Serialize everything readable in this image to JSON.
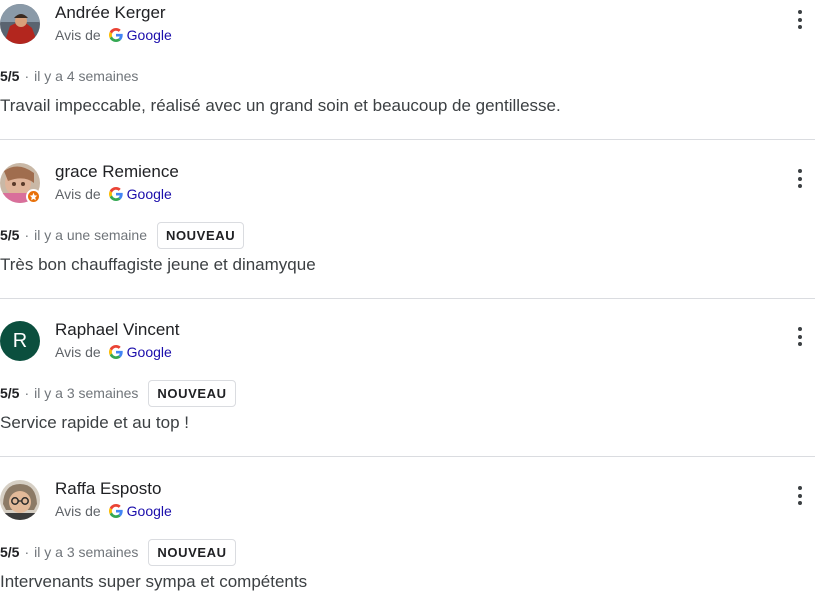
{
  "source_prefix": "Avis de",
  "source_name": "Google",
  "colors": {
    "name": "#202124",
    "muted": "#70757a",
    "link": "#1a0dab",
    "divider": "#dadce0",
    "avatar_raphael": "#0b4f3e",
    "local_guide_badge": "#e8710a"
  },
  "icons": {
    "source": "google-g-icon",
    "menu": "more-vertical-icon",
    "badge": "local-guide-star-icon"
  },
  "reviews": [
    {
      "author": "Andrée Kerger",
      "rating": "5/5",
      "separator": "·",
      "date": "il y a 4 semaines",
      "badge": "",
      "text": "Travail impeccable, réalisé avec un grand soin et beaucoup de gentillesse."
    },
    {
      "author": "grace Remience",
      "rating": "5/5",
      "separator": "·",
      "date": "il y a une semaine",
      "badge": "NOUVEAU",
      "text": "Très bon chauffagiste jeune et dinamyque"
    },
    {
      "author": "Raphael Vincent",
      "avatar_letter": "R",
      "rating": "5/5",
      "separator": "·",
      "date": "il y a 3 semaines",
      "badge": "NOUVEAU",
      "text": "Service rapide et au top !"
    },
    {
      "author": "Raffa Esposto",
      "rating": "5/5",
      "separator": "·",
      "date": "il y a 3 semaines",
      "badge": "NOUVEAU",
      "text": "Intervenants super sympa et compétents"
    }
  ]
}
